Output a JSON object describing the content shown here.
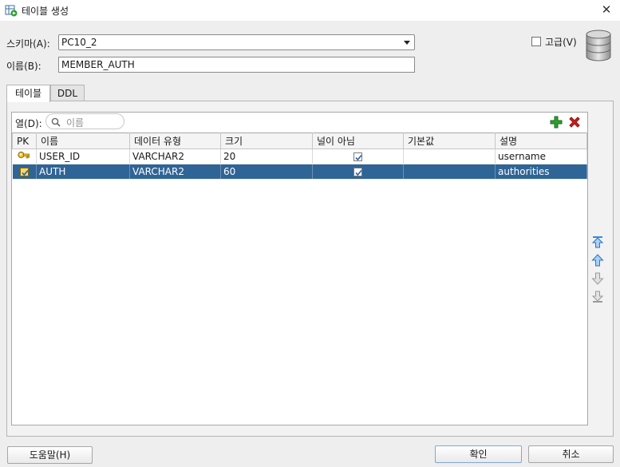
{
  "window": {
    "title": "테이블 생성"
  },
  "form": {
    "schema_label": "스키마(A):",
    "schema_value": "PC10_2",
    "name_label": "이름(B):",
    "name_value": "MEMBER_AUTH",
    "advanced_label": "고급(V)",
    "advanced_checked": false
  },
  "tabs": [
    {
      "label": "테이블",
      "active": true
    },
    {
      "label": "DDL",
      "active": false
    }
  ],
  "columns_section": {
    "label": "열(D):",
    "search_placeholder": "이름"
  },
  "grid": {
    "headers": [
      "PK",
      "이름",
      "데이터 유형",
      "크기",
      "널이 아님",
      "기본값",
      "설명"
    ],
    "rows": [
      {
        "pk": "key",
        "name": "USER_ID",
        "type": "VARCHAR2",
        "size": "20",
        "not_null": true,
        "default": "",
        "comment": "username",
        "selected": false
      },
      {
        "pk": "checked",
        "name": "AUTH",
        "type": "VARCHAR2",
        "size": "60",
        "not_null": true,
        "default": "",
        "comment": "authorities",
        "selected": true
      }
    ]
  },
  "buttons": {
    "help": "도움말(H)",
    "ok": "확인",
    "cancel": "취소"
  },
  "icons": {
    "title": "table-create-icon",
    "add": "green-plus-icon",
    "delete": "red-x-icon",
    "move_top": "move-top-icon",
    "move_up": "move-up-icon",
    "move_down": "move-down-icon",
    "move_bottom": "move-bottom-icon",
    "database": "database-icon"
  },
  "colors": {
    "selected_row": "#2f6496",
    "add_icon": "#2f9e2f",
    "delete_icon": "#d32020"
  }
}
